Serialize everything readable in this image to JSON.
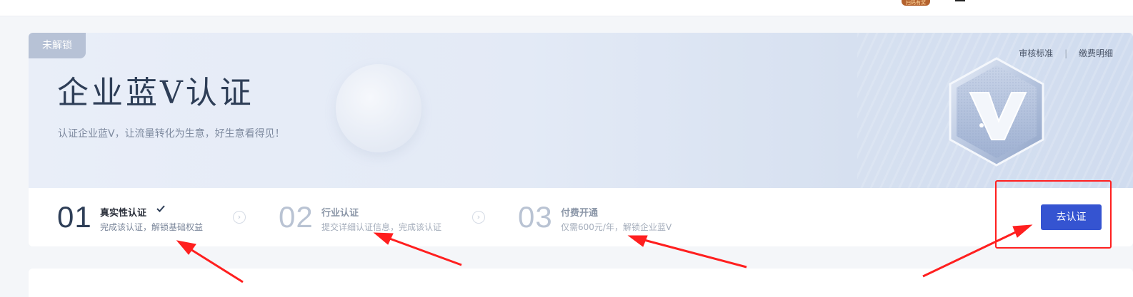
{
  "topbar": {
    "badge_text": "扫码有奖"
  },
  "banner": {
    "lock_badge": "未解锁",
    "title": "企业蓝V认证",
    "subtitle": "认证企业蓝V，让流量转化为生意，好生意看得见！",
    "links": [
      {
        "label": "审核标准"
      },
      {
        "label": "缴费明细"
      }
    ],
    "link_separator": "|",
    "emblem_icon": "blue-v-hexagon-icon"
  },
  "steps": [
    {
      "number": "01",
      "title": "真实性认证",
      "desc": "完成该认证，解锁基础权益",
      "completed": true
    },
    {
      "number": "02",
      "title": "行业认证",
      "desc": "提交详细认证信息，完成该认证",
      "completed": false
    },
    {
      "number": "03",
      "title": "付费开通",
      "desc": "仅需600元/年，解锁企业蓝V",
      "completed": false
    }
  ],
  "step_arrow_glyph": "›",
  "cta": {
    "label": "去认证"
  },
  "colors": {
    "accent": "#3554d1",
    "annotation_red": "#ff1f1f",
    "title_dark": "#2e3e57",
    "step_inactive": "#b9c3d3"
  }
}
